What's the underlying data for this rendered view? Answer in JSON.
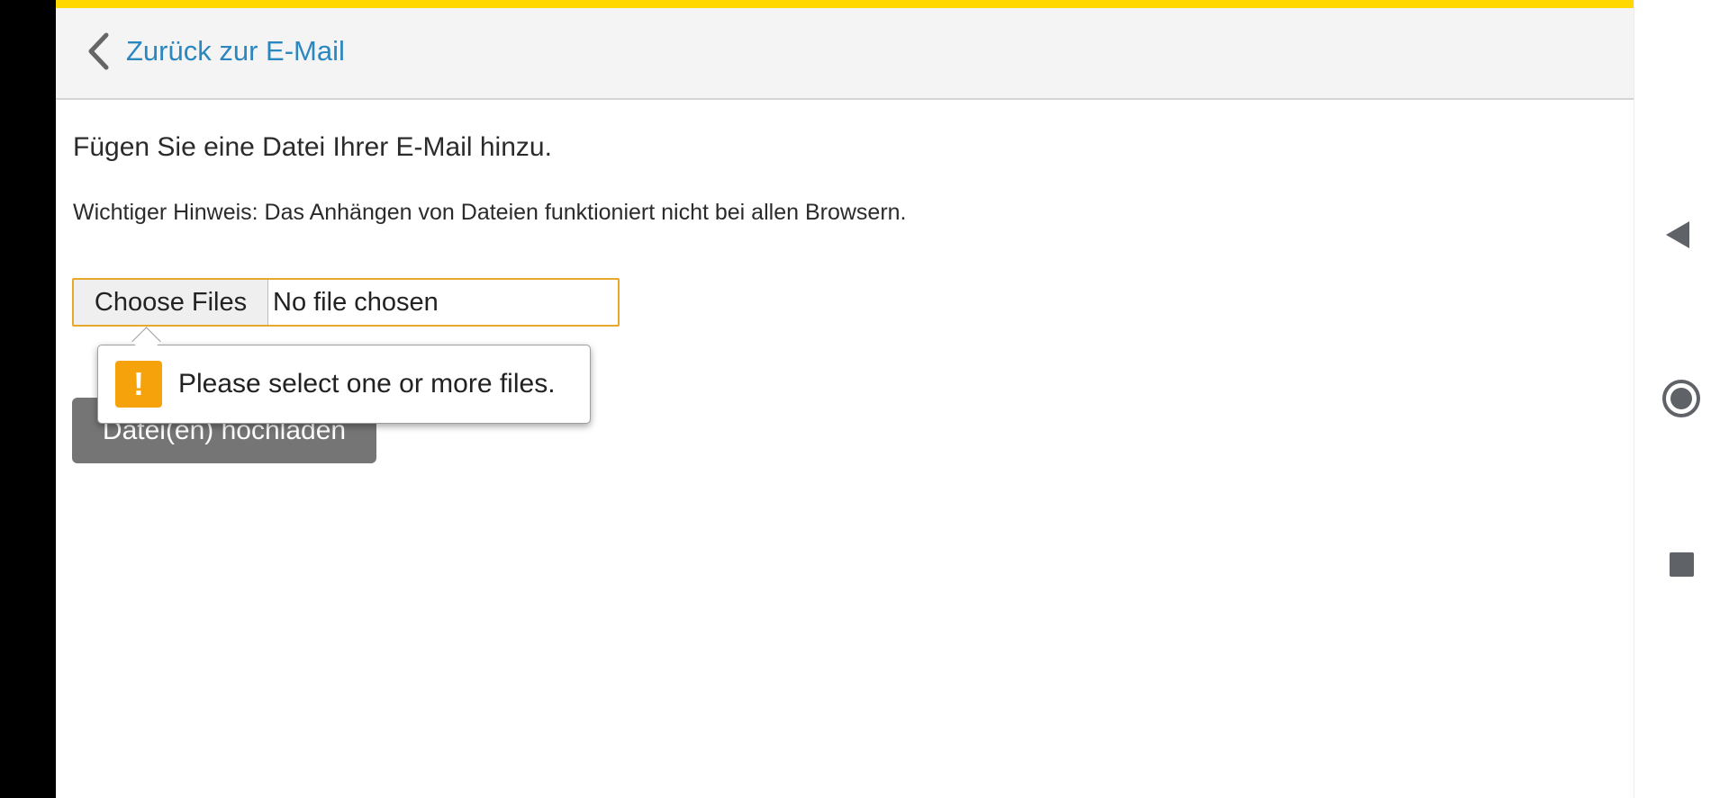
{
  "header": {
    "back_label": "Zurück zur E-Mail",
    "accent_color": "#ffd800",
    "link_color": "#2b87c0"
  },
  "main": {
    "title": "Fügen Sie eine Datei Ihrer E-Mail hinzu.",
    "note": "Wichtiger Hinweis: Das Anhängen von Dateien funktioniert nicht bei allen Browsern.",
    "file_input": {
      "button_label": "Choose Files",
      "status": "No file chosen",
      "border_color": "#e7a92b"
    },
    "upload_button_label": "Datei(en) hochladen",
    "validation_tooltip": {
      "icon": "warning-icon",
      "icon_glyph": "!",
      "icon_color": "#f6a20b",
      "message": "Please select one or more files."
    }
  },
  "system_nav": {
    "back_icon": "triangle-back-icon",
    "home_icon": "circle-home-icon",
    "recents_icon": "square-recents-icon"
  }
}
